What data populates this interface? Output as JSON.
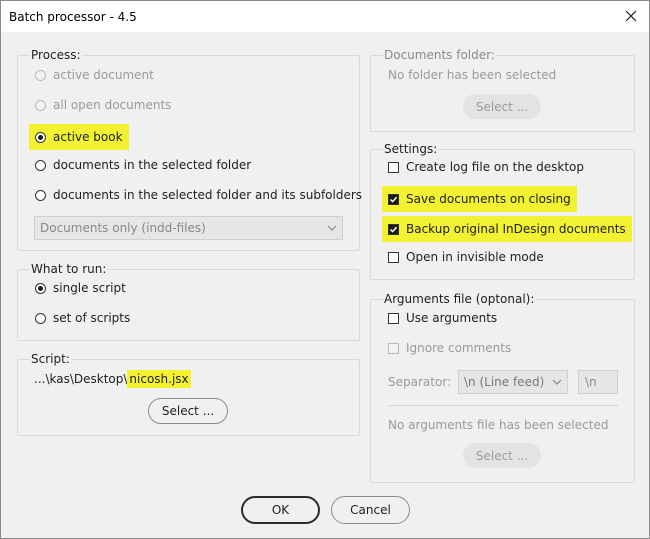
{
  "window": {
    "title": "Batch processor - 4.5"
  },
  "process": {
    "legend": "Process:",
    "options": [
      {
        "label": "active document"
      },
      {
        "label": "all open documents"
      },
      {
        "label": "active book"
      },
      {
        "label": "documents in the selected folder"
      },
      {
        "label": "documents in the selected folder and its subfolders"
      }
    ],
    "file_type": "Documents only (indd-files)"
  },
  "what_to_run": {
    "legend": "What to run:",
    "options": [
      {
        "label": "single script"
      },
      {
        "label": "set of scripts"
      }
    ]
  },
  "script": {
    "legend": "Script:",
    "path_prefix": "...\\kas\\Desktop\\",
    "filename": "nicosh.jsx",
    "select_label": "Select ..."
  },
  "documents_folder": {
    "legend": "Documents folder:",
    "status": "No folder has been selected",
    "select_label": "Select ..."
  },
  "settings": {
    "legend": "Settings:",
    "options": [
      {
        "label": "Create log file on the desktop",
        "checked": false
      },
      {
        "label": "Save documents on closing",
        "checked": true
      },
      {
        "label": "Backup original InDesign documents",
        "checked": true
      },
      {
        "label": "Open in invisible mode",
        "checked": false
      }
    ]
  },
  "arguments": {
    "legend": "Arguments file (optonal):",
    "use_arguments": "Use arguments",
    "ignore_comments": "Ignore comments",
    "separator_label": "Separator:",
    "separator_value": "\\n (Line feed)",
    "separator_char": "\\n",
    "status": "No arguments file has been selected",
    "select_label": "Select ..."
  },
  "footer": {
    "ok_label": "OK",
    "cancel_label": "Cancel"
  },
  "colors": {
    "highlight": "#f2f233",
    "background": "#f0f0f0"
  }
}
